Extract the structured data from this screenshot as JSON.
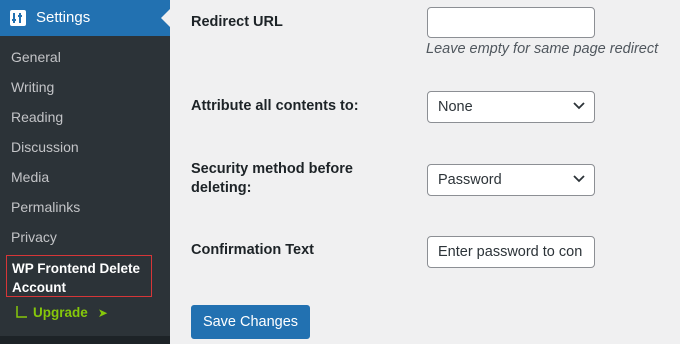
{
  "sidebar": {
    "header_title": "Settings",
    "items": [
      {
        "label": "General"
      },
      {
        "label": "Writing"
      },
      {
        "label": "Reading"
      },
      {
        "label": "Discussion"
      },
      {
        "label": "Media"
      },
      {
        "label": "Permalinks"
      },
      {
        "label": "Privacy"
      }
    ],
    "active_item": "WP Frontend Delete Account",
    "upgrade_label": "Upgrade",
    "upgrade_arrow": "➤"
  },
  "form": {
    "redirect_url_label": "Redirect URL",
    "redirect_url_value": "",
    "redirect_url_description": "Leave empty for same page redirect",
    "attribute_label": "Attribute all contents to:",
    "attribute_value": "None",
    "security_label": "Security method before deleting:",
    "security_value": "Password",
    "confirmation_label": "Confirmation Text",
    "confirmation_value": "Enter password to con",
    "save_label": "Save Changes"
  },
  "colors": {
    "sidebar_bg": "#2c3338",
    "accent": "#2271b1",
    "highlight_border": "#d63638",
    "upgrade": "#86c80a"
  }
}
